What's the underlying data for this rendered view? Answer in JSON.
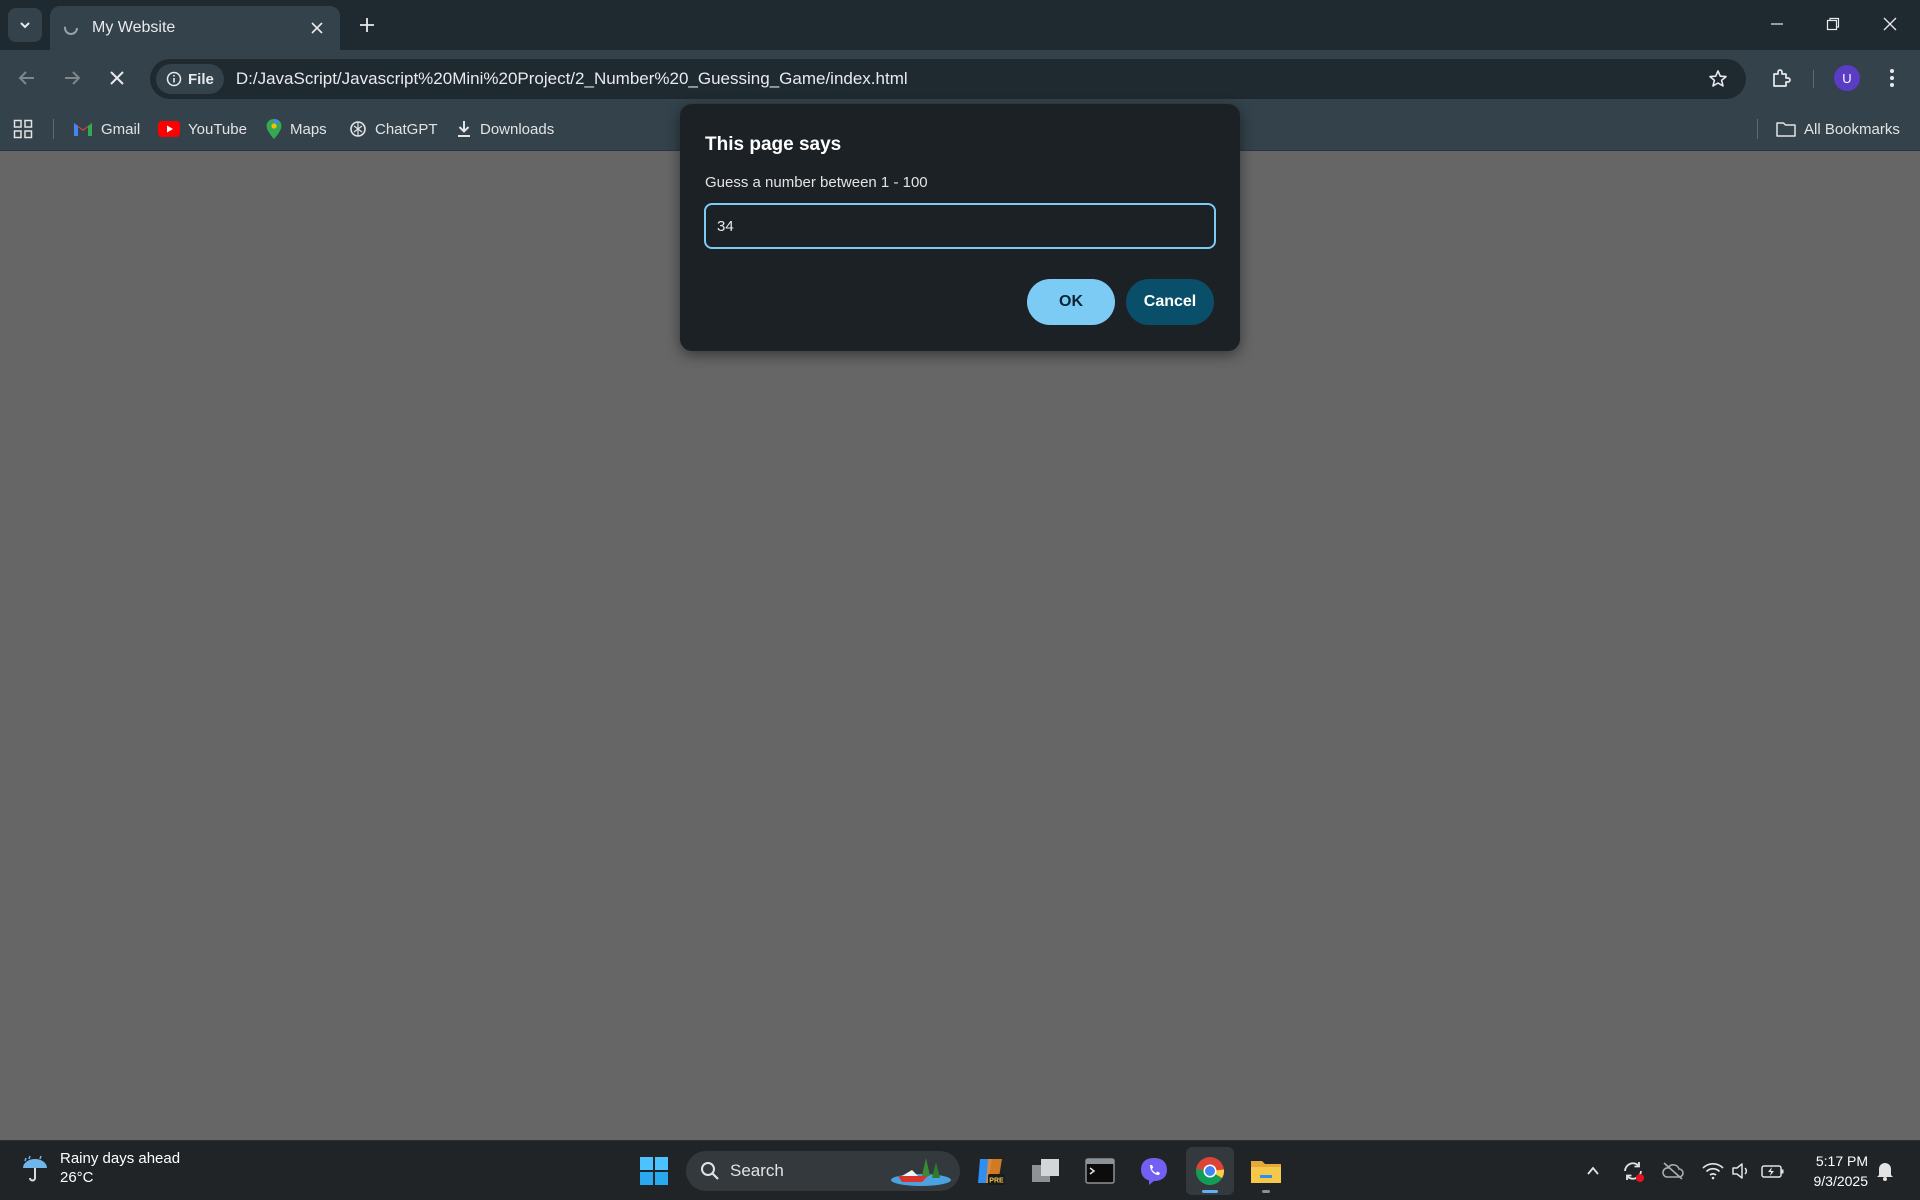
{
  "browser": {
    "tab": {
      "title": "My Website"
    },
    "omnibox": {
      "scheme_chip": "File",
      "url": "D:/JavaScript/Javascript%20Mini%20Project/2_Number%20_Guessing_Game/index.html"
    },
    "avatar_letter": "U",
    "bookmarks": [
      {
        "label": "Gmail",
        "icon": "gmail-icon"
      },
      {
        "label": "YouTube",
        "icon": "youtube-icon"
      },
      {
        "label": "Maps",
        "icon": "maps-icon"
      },
      {
        "label": "ChatGPT",
        "icon": "chatgpt-icon"
      },
      {
        "label": "Downloads",
        "icon": "download-icon"
      }
    ],
    "all_bookmarks": "All Bookmarks"
  },
  "dialog": {
    "title": "This page says",
    "message": "Guess a number between 1 - 100",
    "input_value": "34",
    "ok_label": "OK",
    "cancel_label": "Cancel"
  },
  "taskbar": {
    "weather": {
      "line1": "Rainy days ahead",
      "line2": "26°C"
    },
    "search_label": "Search",
    "time": "5:17 PM",
    "date": "9/3/2025"
  },
  "colors": {
    "page_bg": "#666666",
    "chrome_bg": "#33424b",
    "dialog_bg": "#1c2126",
    "ok_button": "#7ccbf5",
    "cancel_button": "#0a4f6a"
  }
}
